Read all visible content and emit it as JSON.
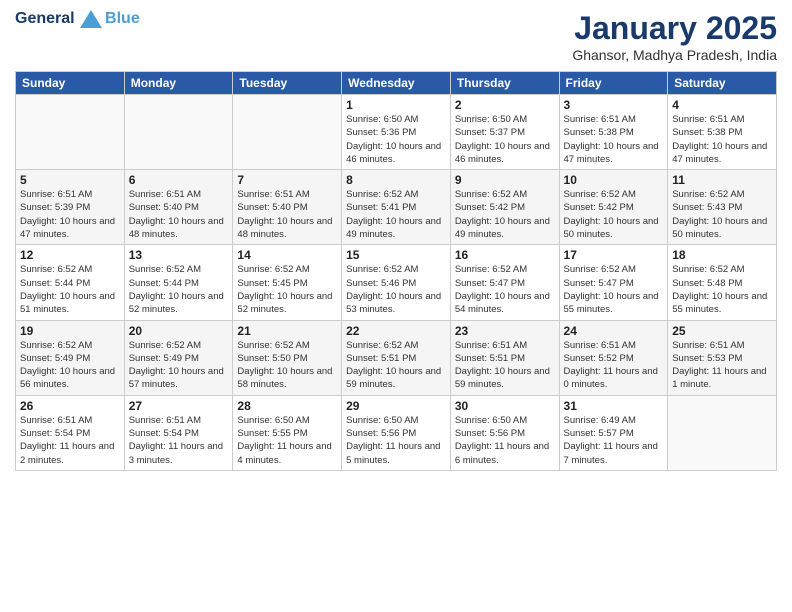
{
  "header": {
    "logo_line1": "General",
    "logo_line2": "Blue",
    "title": "January 2025",
    "subtitle": "Ghansor, Madhya Pradesh, India"
  },
  "days_of_week": [
    "Sunday",
    "Monday",
    "Tuesday",
    "Wednesday",
    "Thursday",
    "Friday",
    "Saturday"
  ],
  "weeks": [
    [
      {
        "day": "",
        "info": ""
      },
      {
        "day": "",
        "info": ""
      },
      {
        "day": "",
        "info": ""
      },
      {
        "day": "1",
        "info": "Sunrise: 6:50 AM\nSunset: 5:36 PM\nDaylight: 10 hours and 46 minutes."
      },
      {
        "day": "2",
        "info": "Sunrise: 6:50 AM\nSunset: 5:37 PM\nDaylight: 10 hours and 46 minutes."
      },
      {
        "day": "3",
        "info": "Sunrise: 6:51 AM\nSunset: 5:38 PM\nDaylight: 10 hours and 47 minutes."
      },
      {
        "day": "4",
        "info": "Sunrise: 6:51 AM\nSunset: 5:38 PM\nDaylight: 10 hours and 47 minutes."
      }
    ],
    [
      {
        "day": "5",
        "info": "Sunrise: 6:51 AM\nSunset: 5:39 PM\nDaylight: 10 hours and 47 minutes."
      },
      {
        "day": "6",
        "info": "Sunrise: 6:51 AM\nSunset: 5:40 PM\nDaylight: 10 hours and 48 minutes."
      },
      {
        "day": "7",
        "info": "Sunrise: 6:51 AM\nSunset: 5:40 PM\nDaylight: 10 hours and 48 minutes."
      },
      {
        "day": "8",
        "info": "Sunrise: 6:52 AM\nSunset: 5:41 PM\nDaylight: 10 hours and 49 minutes."
      },
      {
        "day": "9",
        "info": "Sunrise: 6:52 AM\nSunset: 5:42 PM\nDaylight: 10 hours and 49 minutes."
      },
      {
        "day": "10",
        "info": "Sunrise: 6:52 AM\nSunset: 5:42 PM\nDaylight: 10 hours and 50 minutes."
      },
      {
        "day": "11",
        "info": "Sunrise: 6:52 AM\nSunset: 5:43 PM\nDaylight: 10 hours and 50 minutes."
      }
    ],
    [
      {
        "day": "12",
        "info": "Sunrise: 6:52 AM\nSunset: 5:44 PM\nDaylight: 10 hours and 51 minutes."
      },
      {
        "day": "13",
        "info": "Sunrise: 6:52 AM\nSunset: 5:44 PM\nDaylight: 10 hours and 52 minutes."
      },
      {
        "day": "14",
        "info": "Sunrise: 6:52 AM\nSunset: 5:45 PM\nDaylight: 10 hours and 52 minutes."
      },
      {
        "day": "15",
        "info": "Sunrise: 6:52 AM\nSunset: 5:46 PM\nDaylight: 10 hours and 53 minutes."
      },
      {
        "day": "16",
        "info": "Sunrise: 6:52 AM\nSunset: 5:47 PM\nDaylight: 10 hours and 54 minutes."
      },
      {
        "day": "17",
        "info": "Sunrise: 6:52 AM\nSunset: 5:47 PM\nDaylight: 10 hours and 55 minutes."
      },
      {
        "day": "18",
        "info": "Sunrise: 6:52 AM\nSunset: 5:48 PM\nDaylight: 10 hours and 55 minutes."
      }
    ],
    [
      {
        "day": "19",
        "info": "Sunrise: 6:52 AM\nSunset: 5:49 PM\nDaylight: 10 hours and 56 minutes."
      },
      {
        "day": "20",
        "info": "Sunrise: 6:52 AM\nSunset: 5:49 PM\nDaylight: 10 hours and 57 minutes."
      },
      {
        "day": "21",
        "info": "Sunrise: 6:52 AM\nSunset: 5:50 PM\nDaylight: 10 hours and 58 minutes."
      },
      {
        "day": "22",
        "info": "Sunrise: 6:52 AM\nSunset: 5:51 PM\nDaylight: 10 hours and 59 minutes."
      },
      {
        "day": "23",
        "info": "Sunrise: 6:51 AM\nSunset: 5:51 PM\nDaylight: 10 hours and 59 minutes."
      },
      {
        "day": "24",
        "info": "Sunrise: 6:51 AM\nSunset: 5:52 PM\nDaylight: 11 hours and 0 minutes."
      },
      {
        "day": "25",
        "info": "Sunrise: 6:51 AM\nSunset: 5:53 PM\nDaylight: 11 hours and 1 minute."
      }
    ],
    [
      {
        "day": "26",
        "info": "Sunrise: 6:51 AM\nSunset: 5:54 PM\nDaylight: 11 hours and 2 minutes."
      },
      {
        "day": "27",
        "info": "Sunrise: 6:51 AM\nSunset: 5:54 PM\nDaylight: 11 hours and 3 minutes."
      },
      {
        "day": "28",
        "info": "Sunrise: 6:50 AM\nSunset: 5:55 PM\nDaylight: 11 hours and 4 minutes."
      },
      {
        "day": "29",
        "info": "Sunrise: 6:50 AM\nSunset: 5:56 PM\nDaylight: 11 hours and 5 minutes."
      },
      {
        "day": "30",
        "info": "Sunrise: 6:50 AM\nSunset: 5:56 PM\nDaylight: 11 hours and 6 minutes."
      },
      {
        "day": "31",
        "info": "Sunrise: 6:49 AM\nSunset: 5:57 PM\nDaylight: 11 hours and 7 minutes."
      },
      {
        "day": "",
        "info": ""
      }
    ]
  ]
}
